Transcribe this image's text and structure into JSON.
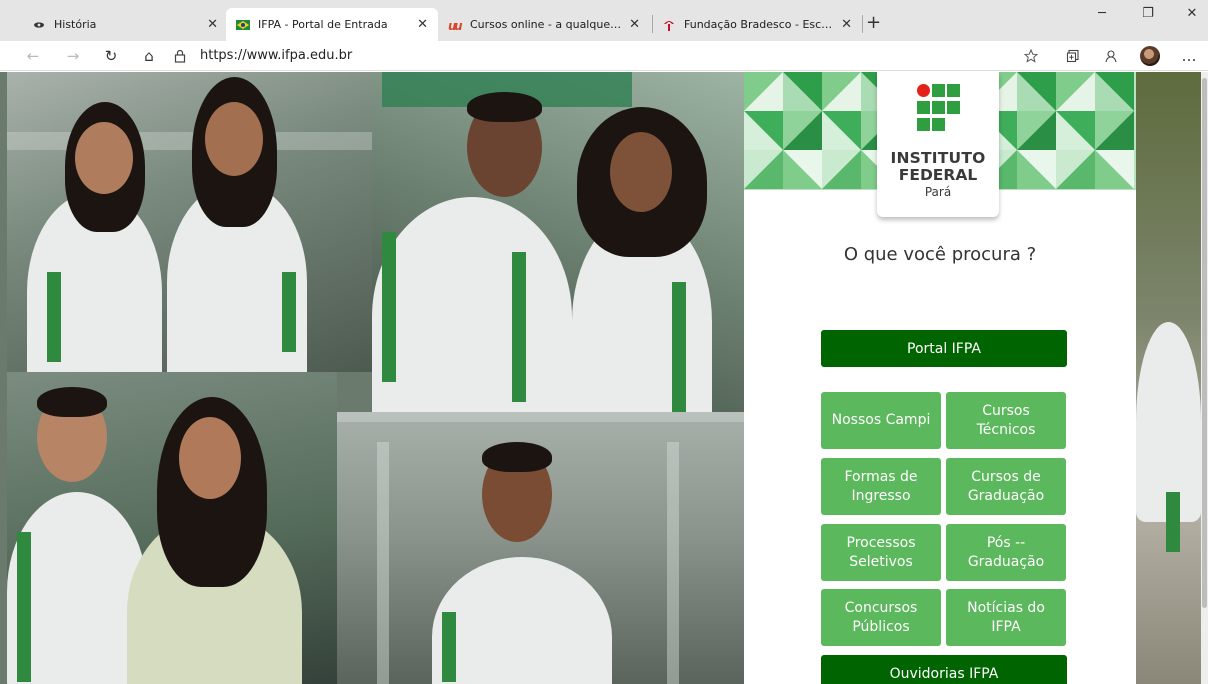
{
  "browser": {
    "tabs": [
      {
        "label": "História",
        "close": "✕"
      },
      {
        "label": "IFPA - Portal de Entrada",
        "close": "✕"
      },
      {
        "label": "Cursos online - a qualquer hora,",
        "close": "✕"
      },
      {
        "label": "Fundação Bradesco - Escola Virtu",
        "close": "✕"
      }
    ],
    "new_tab": "+",
    "window": {
      "minimize": "─",
      "maximize": "❐",
      "close": "✕"
    },
    "url": "https://www.ifpa.edu.br",
    "nav": {
      "back": "←",
      "forward": "→",
      "refresh": "↻",
      "home": "⌂",
      "more": "…"
    }
  },
  "logo": {
    "line1": "INSTITUTO",
    "line2": "FEDERAL",
    "line3": "Pará"
  },
  "prompt": "O que você procura ?",
  "primary_button": "Portal IFPA",
  "menu_buttons": [
    {
      "label": "Nossos Campi"
    },
    {
      "label": "Cursos Técnicos"
    },
    {
      "label": "Formas de Ingresso"
    },
    {
      "label": "Cursos de Graduação"
    },
    {
      "label": "Processos Seletivos"
    },
    {
      "label": "Pós -- Graduação"
    },
    {
      "label": "Concursos Públicos"
    },
    {
      "label": "Notícias do IFPA"
    }
  ],
  "bottom_button": "Ouvidorias IFPA",
  "colors": {
    "dark_green": "#006400",
    "button_green": "#5cb85c",
    "logo_red": "#e2231a",
    "logo_green": "#2f9e41"
  }
}
